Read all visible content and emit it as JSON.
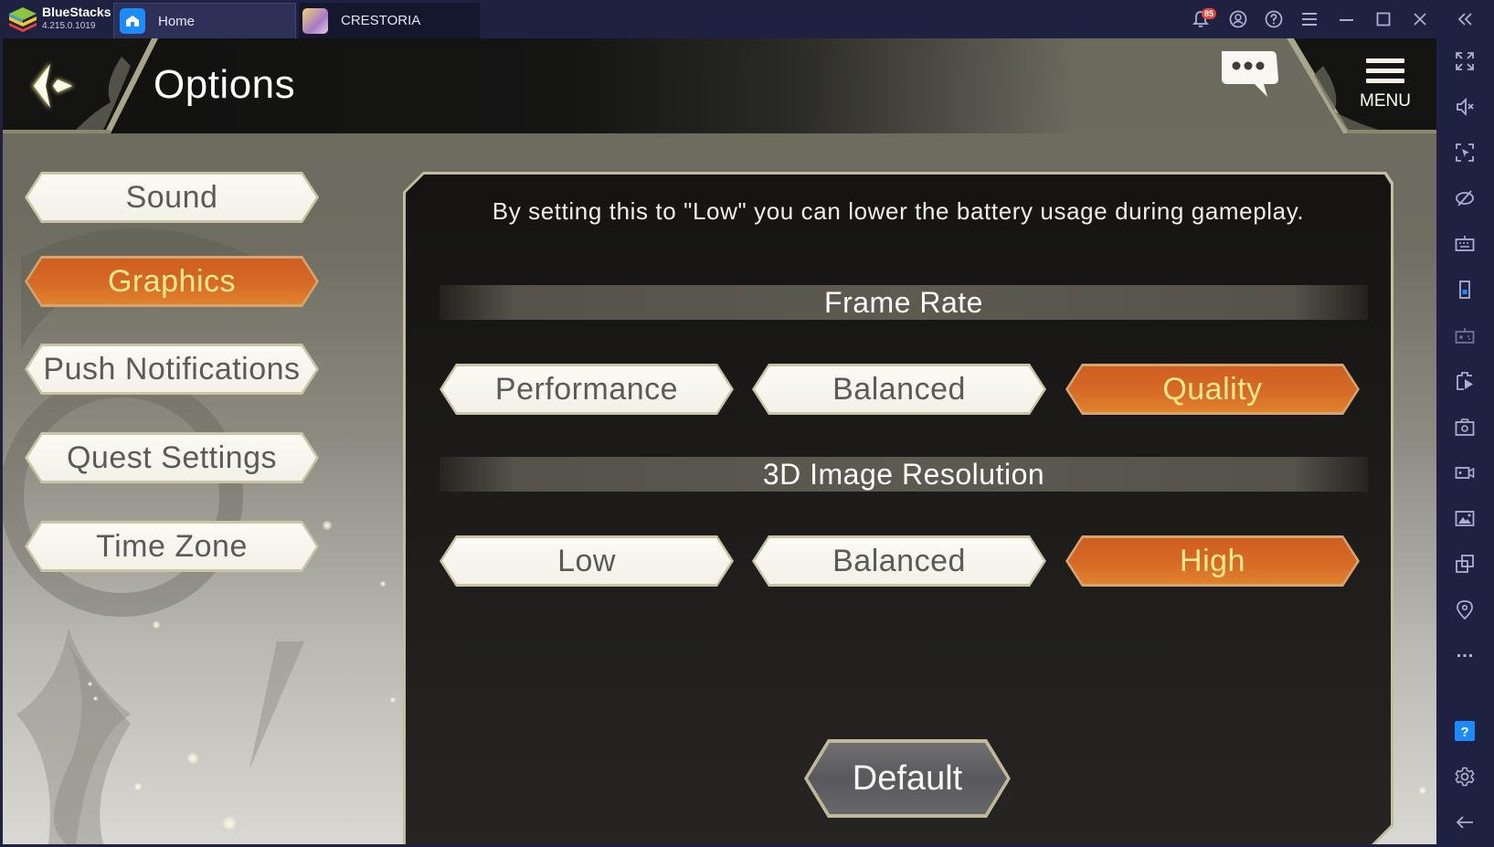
{
  "app": {
    "brand_name": "BlueStacks",
    "version": "4.215.0.1019",
    "tabs": [
      {
        "label": "Home",
        "icon": "home-icon",
        "active": false
      },
      {
        "label": "CRESTORIA",
        "icon": "game-avatar-icon",
        "active": true
      }
    ],
    "notifications_count": "85",
    "titlebar_icons": [
      "bell-icon",
      "account-icon",
      "help-icon",
      "hamburger-icon",
      "minimize-icon",
      "maximize-icon",
      "close-icon",
      "collapse-sidebar-icon"
    ],
    "sidebar_icons": [
      "fullscreen-icon",
      "mute-icon",
      "pointer-lock-icon",
      "eye-off-icon",
      "keyboard-icon",
      "phone-rotate-icon",
      "gamepad-icon",
      "media-play-icon",
      "camera-icon",
      "video-record-icon",
      "gallery-icon",
      "multi-instance-icon",
      "location-icon",
      "more-icon",
      "help-square-icon",
      "settings-icon",
      "back-arrow-icon"
    ]
  },
  "game": {
    "page_title": "Options",
    "menu_label": "MENU",
    "categories": [
      {
        "label": "Sound",
        "active": false
      },
      {
        "label": "Graphics",
        "active": true
      },
      {
        "label": "Push Notifications",
        "active": false
      },
      {
        "label": "Quest Settings",
        "active": false
      },
      {
        "label": "Time Zone",
        "active": false
      }
    ],
    "panel": {
      "description": "By setting this to \"Low\" you can lower the battery usage during gameplay.",
      "sections": [
        {
          "title": "Frame Rate",
          "options": [
            "Performance",
            "Balanced",
            "Quality"
          ],
          "selected": "Quality"
        },
        {
          "title": "3D Image Resolution",
          "options": [
            "Low",
            "Balanced",
            "High"
          ],
          "selected": "High"
        }
      ],
      "default_label": "Default"
    }
  },
  "colors": {
    "accent_orange": "#d6662a",
    "accent_text": "#ffeb8c",
    "bluestacks_chrome": "#1e2240",
    "help_blue": "#1a8cff",
    "badge_red": "#e8433c"
  }
}
